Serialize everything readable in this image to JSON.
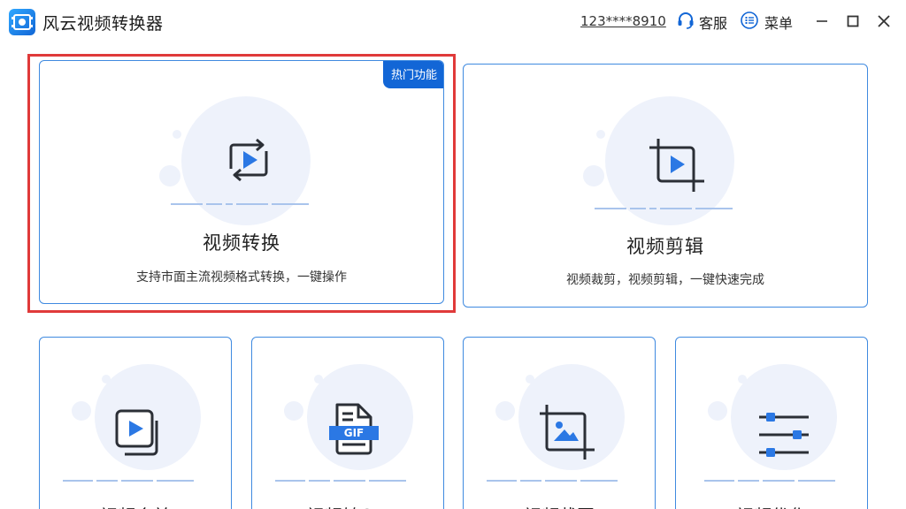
{
  "app": {
    "title": "风云视频转换器",
    "account": "123****8910",
    "service_label": "客服",
    "menu_label": "菜单"
  },
  "colors": {
    "accent": "#1266d6",
    "card_border": "#3f8ae0",
    "highlight": "#e03a3a",
    "icon_dark": "#2b2f36",
    "icon_blue": "#2b78e4"
  },
  "cards": {
    "convert": {
      "badge": "热门功能",
      "title": "视频转换",
      "desc": "支持市面主流视频格式转换，一键操作",
      "icon": "video-convert-icon"
    },
    "edit": {
      "title": "视频剪辑",
      "desc": "视频裁剪，视频剪辑，一键快速完成",
      "icon": "video-crop-icon"
    },
    "small": [
      {
        "icon": "video-merge-icon",
        "title": "视频合并"
      },
      {
        "icon": "gif-file-icon",
        "title": "视频转GIF"
      },
      {
        "icon": "crop-image-icon",
        "title": "视频截图"
      },
      {
        "icon": "sliders-icon",
        "title": "视频优化"
      }
    ]
  },
  "gif_label": "GIF"
}
